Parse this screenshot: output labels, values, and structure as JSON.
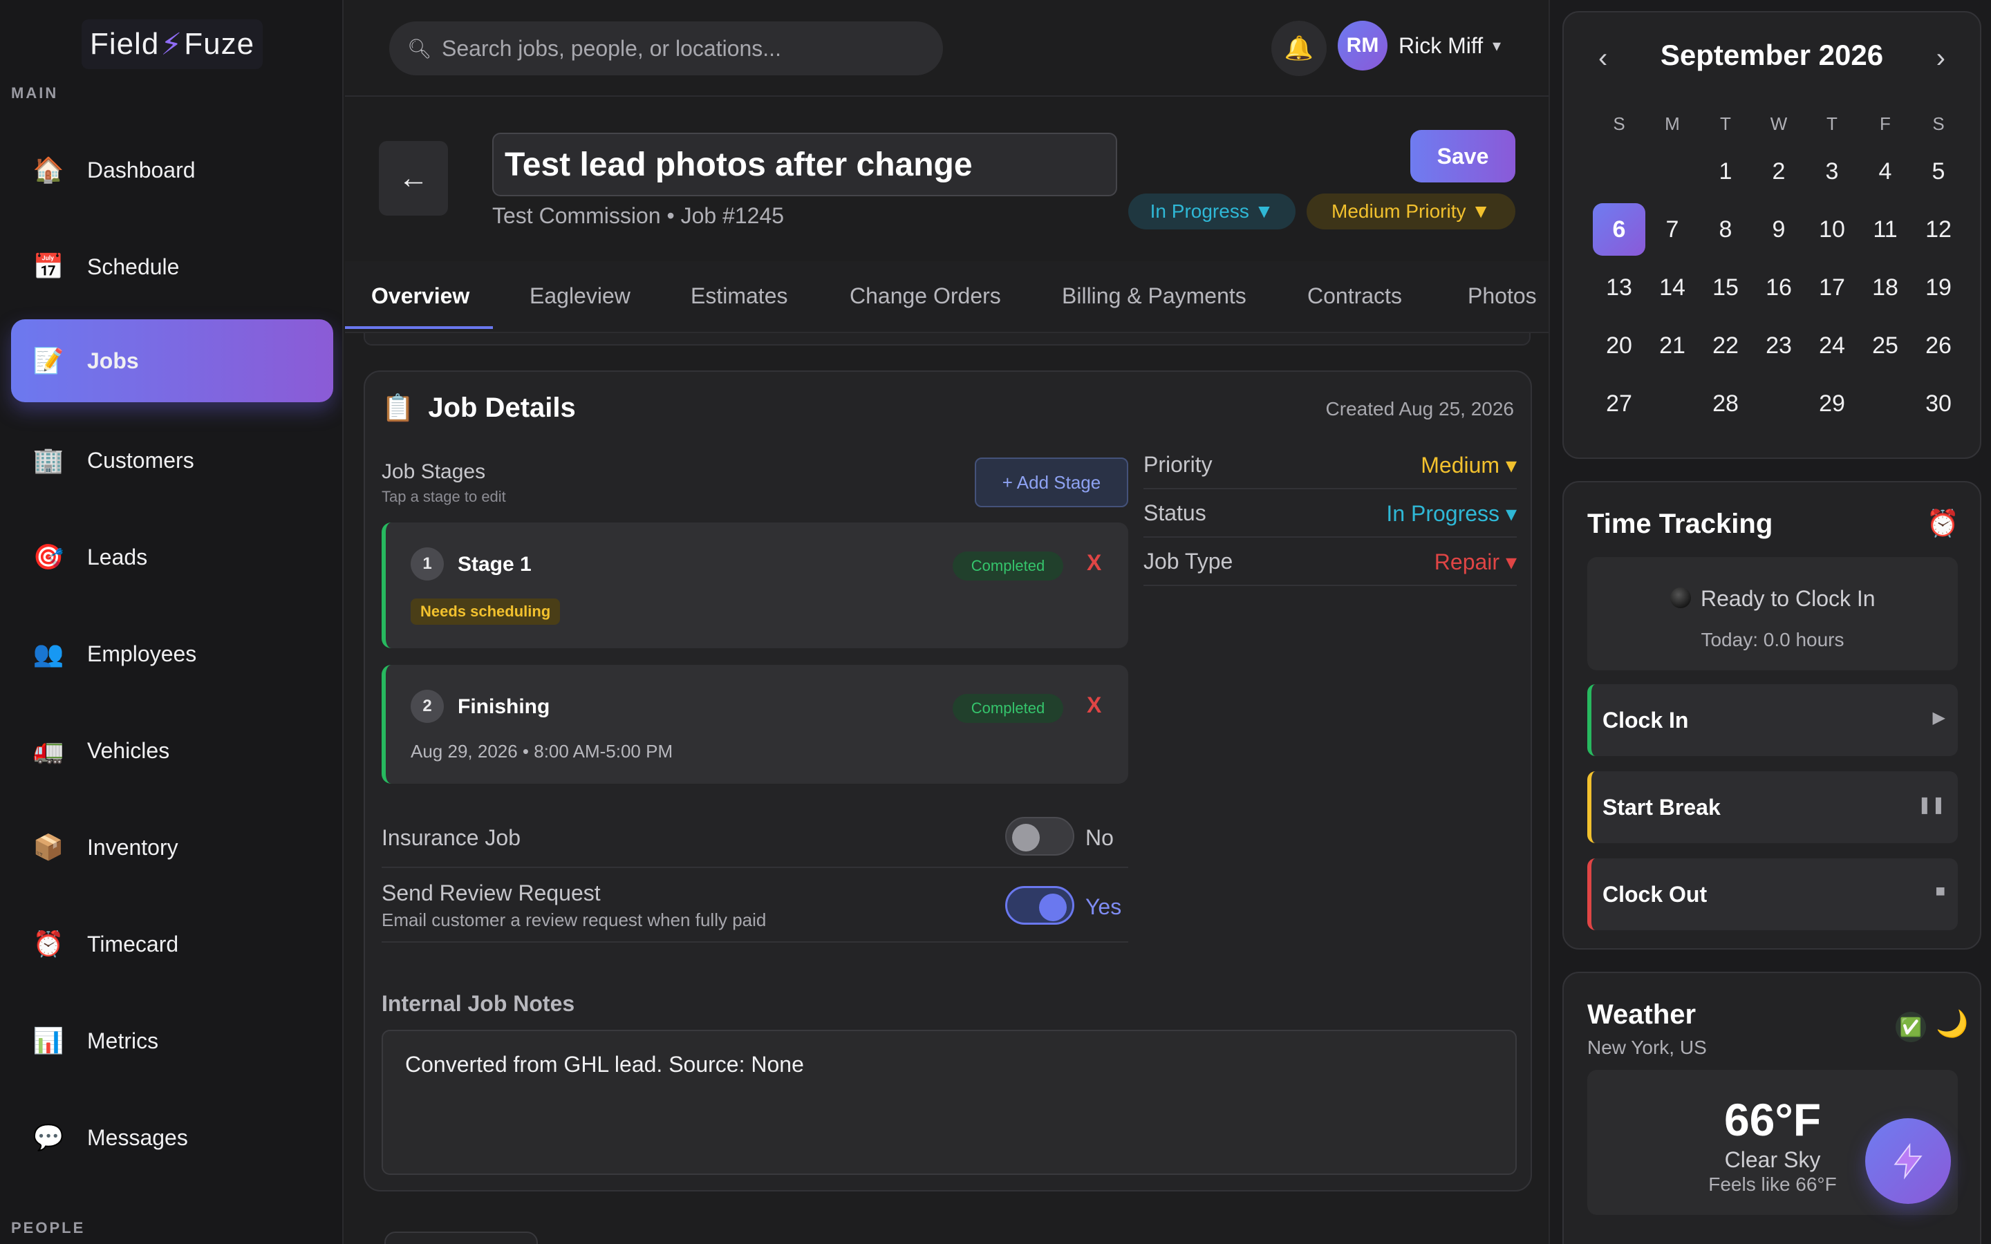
{
  "app": {
    "brand_left": "Field",
    "brand_right": "Fuze"
  },
  "sidebar": {
    "section_main": "MAIN",
    "section_people": "PEOPLE",
    "items": [
      {
        "label": "Dashboard",
        "icon": "house-icon",
        "glyph": "🏠"
      },
      {
        "label": "Schedule",
        "icon": "calendar-icon",
        "glyph": "📅"
      },
      {
        "label": "Jobs",
        "icon": "memo-icon",
        "glyph": "📝",
        "active": true
      },
      {
        "label": "Customers",
        "icon": "building-icon",
        "glyph": "🏢"
      },
      {
        "label": "Leads",
        "icon": "target-icon",
        "glyph": "🎯"
      },
      {
        "label": "Employees",
        "icon": "people-icon",
        "glyph": "👥"
      },
      {
        "label": "Vehicles",
        "icon": "truck-icon",
        "glyph": "🚛"
      },
      {
        "label": "Inventory",
        "icon": "package-icon",
        "glyph": "📦"
      },
      {
        "label": "Timecard",
        "icon": "alarm-clock-icon",
        "glyph": "⏰"
      },
      {
        "label": "Metrics",
        "icon": "bar-chart-icon",
        "glyph": "📊"
      },
      {
        "label": "Messages",
        "icon": "speech-bubble-icon",
        "glyph": "💬"
      }
    ]
  },
  "topbar": {
    "search_placeholder": "Search jobs, people, or locations...",
    "user_initials": "RM",
    "user_name": "Rick Miff",
    "caret": "▾"
  },
  "job": {
    "title": "Test lead photos after change",
    "subtitle": "Test Commission • Job #1245",
    "save_label": "Save",
    "status_pill": "In Progress ▼",
    "priority_pill": "Medium Priority ▼"
  },
  "tabs": [
    "Overview",
    "Eagleview",
    "Estimates",
    "Change Orders",
    "Billing & Payments",
    "Contracts",
    "Photos"
  ],
  "details": {
    "title": "Job Details",
    "created": "Created Aug 25, 2026",
    "stages_label": "Job Stages",
    "stages_hint": "Tap a stage to edit",
    "add_stage": "+ Add Stage",
    "stages": [
      {
        "num": "1",
        "name": "Stage 1",
        "status": "Completed",
        "remove": "X",
        "tag": "Needs scheduling"
      },
      {
        "num": "2",
        "name": "Finishing",
        "status": "Completed",
        "remove": "X",
        "when": "Aug 29, 2026 • 8:00 AM-5:00 PM"
      }
    ],
    "insurance_label": "Insurance Job",
    "insurance_value": "No",
    "review_label": "Send Review Request",
    "review_sub": "Email customer a review request when fully paid",
    "review_value": "Yes",
    "props": [
      {
        "label": "Priority",
        "value": "Medium ▾",
        "color": "#f2c12e"
      },
      {
        "label": "Status",
        "value": "In Progress ▾",
        "color": "#2fb8d6"
      },
      {
        "label": "Job Type",
        "value": "Repair ▾",
        "color": "#e04545"
      }
    ],
    "notes_label": "Internal Job Notes",
    "notes": "Converted from GHL lead. Source: None"
  },
  "calendar": {
    "month": "September 2026",
    "prev": "‹",
    "next": "›",
    "dow": [
      "S",
      "M",
      "T",
      "W",
      "T",
      "F",
      "S"
    ],
    "selected": 6,
    "first_weekday": 2,
    "days": 30
  },
  "time_tracking": {
    "title": "Time Tracking",
    "status": "Ready to Clock In",
    "today": "Today: 0.0 hours",
    "buttons": [
      {
        "label": "Clock In",
        "icon": "play-icon",
        "glyph": "▶",
        "color": "#27b95f"
      },
      {
        "label": "Start Break",
        "icon": "pause-icon",
        "glyph": "❚❚",
        "color": "#f2c12e"
      },
      {
        "label": "Clock Out",
        "icon": "stop-icon",
        "glyph": "■",
        "color": "#e04545"
      }
    ]
  },
  "weather": {
    "title": "Weather",
    "location": "New York, US",
    "temp": "66°F",
    "sky": "Clear Sky",
    "feels": "Feels like 66°F"
  }
}
